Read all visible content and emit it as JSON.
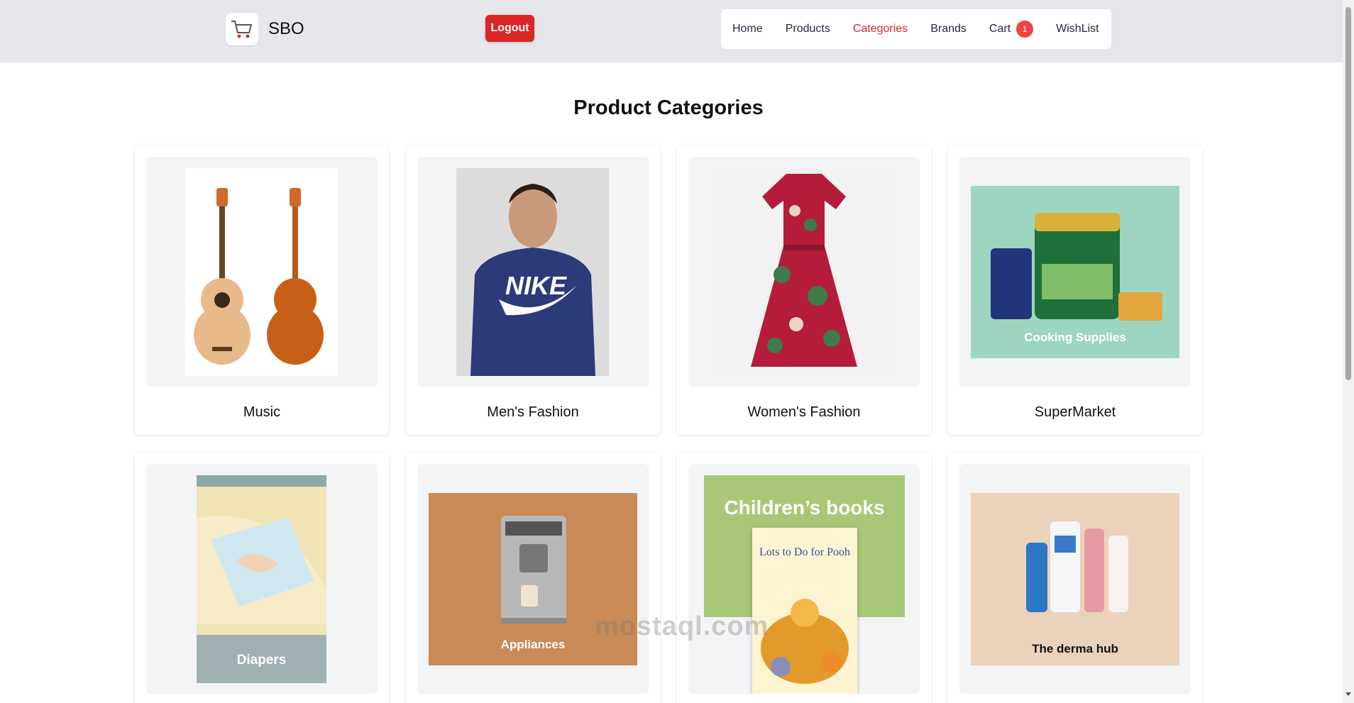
{
  "header": {
    "brand_name": "SBO",
    "logout_label": "Logout",
    "nav": [
      {
        "label": "Home",
        "active": false
      },
      {
        "label": "Products",
        "active": false
      },
      {
        "label": "Categories",
        "active": true
      },
      {
        "label": "Brands",
        "active": false
      },
      {
        "label": "Cart",
        "active": false,
        "badge": "1"
      },
      {
        "label": "WishList",
        "active": false
      }
    ]
  },
  "main": {
    "title": "Product Categories",
    "categories": [
      {
        "name": "Music",
        "image_text": ""
      },
      {
        "name": "Men's Fashion",
        "image_text": "NIKE"
      },
      {
        "name": "Women's Fashion",
        "image_text": ""
      },
      {
        "name": "SuperMarket",
        "image_text": "Cooking Supplies"
      },
      {
        "name": "",
        "image_text": "Diapers"
      },
      {
        "name": "",
        "image_text": "Appliances"
      },
      {
        "name": "",
        "image_text": "Children’s books",
        "book_title": "Lots to Do for Pooh"
      },
      {
        "name": "",
        "image_text": "The derma hub"
      }
    ]
  },
  "watermark": {
    "text": "mostaql.com"
  },
  "colors": {
    "accent": "#dc2626",
    "header_bg": "#e5e7eb",
    "card_inner_bg": "#f3f4f6"
  }
}
